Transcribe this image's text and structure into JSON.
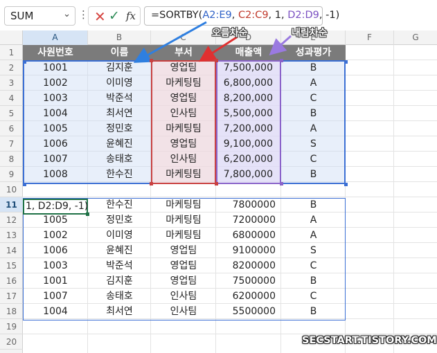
{
  "name_box": {
    "value": "SUM"
  },
  "formula_bar": {
    "prefix": "=SORTBY(",
    "arg1": "A2:E9",
    "sep1": ", ",
    "arg2": "C2:C9",
    "mid": ", 1, ",
    "arg3": "D2:D9",
    "suffix": ", -1)"
  },
  "columns": [
    "A",
    "B",
    "C",
    "D",
    "E",
    "F",
    "G"
  ],
  "rows": [
    "1",
    "2",
    "3",
    "4",
    "5",
    "6",
    "7",
    "8",
    "9",
    "10",
    "11",
    "12",
    "13",
    "14",
    "15",
    "16",
    "17",
    "18",
    "19",
    "20"
  ],
  "table": {
    "headers": [
      "사원번호",
      "이름",
      "부서",
      "매출액",
      "성과평가"
    ],
    "rows": [
      [
        "1001",
        "김지훈",
        "영업팀",
        "7,500,000",
        "B"
      ],
      [
        "1002",
        "이미영",
        "마케팅팀",
        "6,800,000",
        "A"
      ],
      [
        "1003",
        "박준석",
        "영업팀",
        "8,200,000",
        "C"
      ],
      [
        "1004",
        "최서연",
        "인사팀",
        "5,500,000",
        "B"
      ],
      [
        "1005",
        "정민호",
        "마케팅팀",
        "7,200,000",
        "A"
      ],
      [
        "1006",
        "윤혜진",
        "영업팀",
        "9,100,000",
        "S"
      ],
      [
        "1007",
        "송태호",
        "인사팀",
        "6,200,000",
        "C"
      ],
      [
        "1008",
        "한수진",
        "마케팅팀",
        "7,800,000",
        "B"
      ]
    ]
  },
  "result": {
    "active_cell_text": "1, D2:D9, -1)",
    "rows": [
      [
        "",
        "한수진",
        "마케팅팀",
        "7800000",
        "B"
      ],
      [
        "1005",
        "정민호",
        "마케팅팀",
        "7200000",
        "A"
      ],
      [
        "1002",
        "이미영",
        "마케팅팀",
        "6800000",
        "A"
      ],
      [
        "1006",
        "윤혜진",
        "영업팀",
        "9100000",
        "S"
      ],
      [
        "1003",
        "박준석",
        "영업팀",
        "8200000",
        "C"
      ],
      [
        "1001",
        "김지훈",
        "영업팀",
        "7500000",
        "B"
      ],
      [
        "1007",
        "송태호",
        "인사팀",
        "6200000",
        "C"
      ],
      [
        "1004",
        "최서연",
        "인사팀",
        "5500000",
        "B"
      ]
    ]
  },
  "annotations": {
    "ascending": "오름차순",
    "descending": "내림차순"
  },
  "watermark": "SECSTART.TISTORY.COM",
  "colors": {
    "blue_range": "#3b6fd4",
    "red_range": "#c94040",
    "purple_range": "#8a63c9",
    "header_fill": "#7b7b7b",
    "active_border": "#1e7145"
  },
  "icons": {
    "cancel": "x-icon",
    "enter": "check-icon",
    "function": "fx-icon",
    "dropdown": "chevron-down-icon"
  }
}
